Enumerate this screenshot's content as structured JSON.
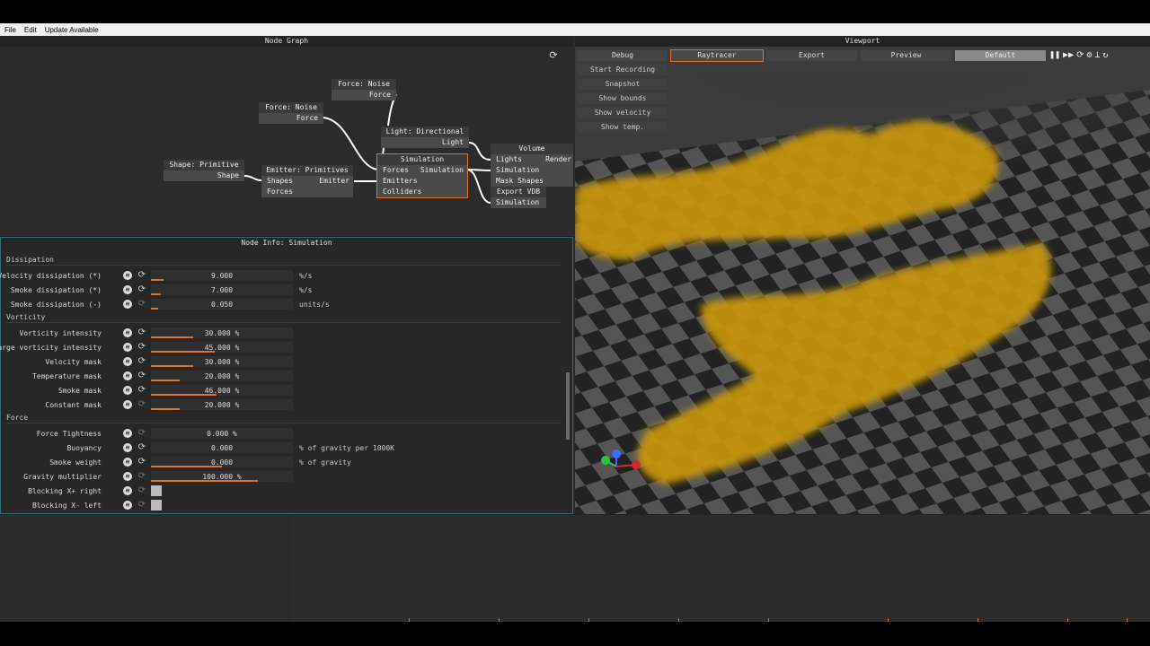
{
  "menu": {
    "file": "File",
    "edit": "Edit",
    "update": "Update Available"
  },
  "node_graph": {
    "title": "Node Graph",
    "refresh_icon": "refresh-icon",
    "nodes": {
      "noise1": {
        "title": "Force: Noise",
        "out": "Force"
      },
      "noise2": {
        "title": "Force: Noise",
        "out": "Force"
      },
      "shape": {
        "title": "Shape: Primitive",
        "out": "Shape"
      },
      "emitter": {
        "title": "Emitter: Primitives",
        "in1": "Shapes",
        "in2": "Forces",
        "out": "Emitter"
      },
      "light": {
        "title": "Light: Directional",
        "out": "Light"
      },
      "sim": {
        "title": "Simulation",
        "in1": "Forces",
        "in2": "Emitters",
        "in3": "Colliders",
        "out": "Simulation"
      },
      "volume": {
        "title": "Volume",
        "in1": "Lights",
        "in2": "Simulation",
        "in3": "Mask Shapes",
        "out": "Render"
      },
      "vdb": {
        "title": "Export VDB",
        "in1": "Simulation"
      }
    }
  },
  "node_info": {
    "title": "Node Info: Simulation",
    "sections": {
      "dissipation": "Dissipation",
      "vorticity": "Vorticity",
      "force": "Force"
    },
    "rows": [
      {
        "label": "Velocity dissipation (*)",
        "value": "9.000",
        "unit": "%/s",
        "fill": 0.09
      },
      {
        "label": "Smoke dissipation (*)",
        "value": "7.000",
        "unit": "%/s",
        "fill": 0.07
      },
      {
        "label": "Smoke dissipation (-)",
        "value": "0.050",
        "unit": "units/s",
        "fill": 0.05
      },
      {
        "label": "Vorticity intensity",
        "value": "30.000 %",
        "unit": "",
        "fill": 0.3
      },
      {
        "label": "Large vorticity intensity",
        "value": "45.000 %",
        "unit": "",
        "fill": 0.45
      },
      {
        "label": "Velocity mask",
        "value": "30.000 %",
        "unit": "",
        "fill": 0.3
      },
      {
        "label": "Temperature mask",
        "value": "20.000 %",
        "unit": "",
        "fill": 0.2
      },
      {
        "label": "Smoke mask",
        "value": "46.000 %",
        "unit": "",
        "fill": 0.46
      },
      {
        "label": "Constant mask",
        "value": "20.000 %",
        "unit": "",
        "fill": 0.2
      },
      {
        "label": "Force Tightness",
        "value": "0.000 %",
        "unit": "",
        "fill": 0
      },
      {
        "label": "Buoyancy",
        "value": "0.000",
        "unit": "% of gravity per 1000K",
        "fill": 0
      },
      {
        "label": "Smoke weight",
        "value": "0.000",
        "unit": "% of gravity",
        "fill": 0.5
      },
      {
        "label": "Gravity multiplier",
        "value": "100.000 %",
        "unit": "",
        "fill": 0.75
      },
      {
        "label": "Blocking X+ right",
        "value": "",
        "unit": "",
        "fill": 0
      },
      {
        "label": "Blocking X- left",
        "value": "",
        "unit": "",
        "fill": 0
      }
    ]
  },
  "viewport": {
    "title": "Viewport",
    "tabs": [
      "Debug",
      "Raytracer",
      "Export",
      "Preview",
      "Default"
    ],
    "buttons": [
      "Start Recording",
      "Snapshot",
      "Show bounds",
      "Show velocity",
      "Show temp."
    ],
    "icons": [
      "pause-icon",
      "fast-forward-icon",
      "reset-icon",
      "settings-icon",
      "camera-icon",
      "reload-icon"
    ]
  },
  "colors": {
    "accent": "#e07030",
    "smoke": "#c8960a"
  }
}
